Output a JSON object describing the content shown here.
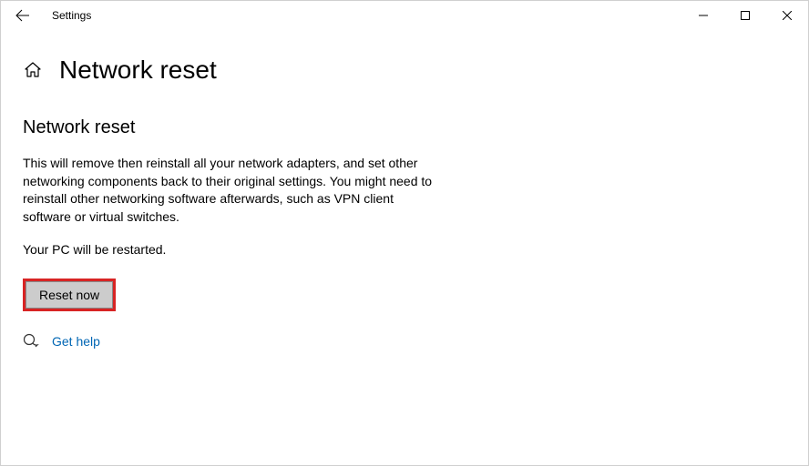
{
  "window": {
    "title": "Settings"
  },
  "header": {
    "page_title": "Network reset"
  },
  "main": {
    "section_title": "Network reset",
    "description": "This will remove then reinstall all your network adapters, and set other networking components back to their original settings. You might need to reinstall other networking software afterwards, such as VPN client software or virtual switches.",
    "restart_note": "Your PC will be restarted.",
    "reset_button_label": "Reset now"
  },
  "footer": {
    "help_label": "Get help"
  },
  "colors": {
    "highlight": "#d82424",
    "link": "#0066b4"
  }
}
